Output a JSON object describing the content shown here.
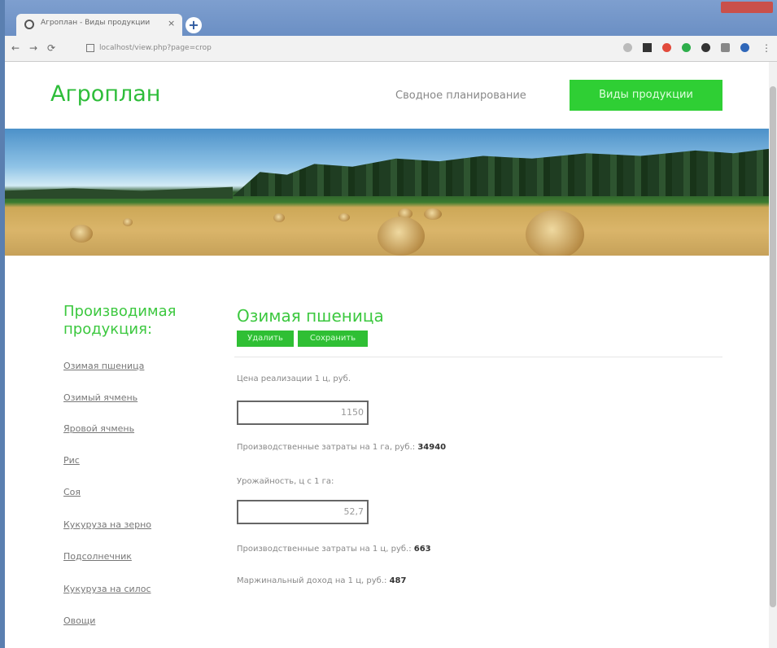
{
  "browser": {
    "tab_title": "Агроплан - Виды продукции",
    "tab_close": "×",
    "new_tab": "+",
    "url": "localhost/view.php?page=crop"
  },
  "header": {
    "logo": "Агроплан",
    "nav_link": "Сводное планирование",
    "nav_button": "Виды продукции",
    "accent_color": "#2fcf34"
  },
  "sidebar": {
    "title_line1": "Производимая",
    "title_line2": "продукция:",
    "items": [
      "Озимая пшеница",
      "Озимый ячмень",
      "Яровой ячмень",
      "Рис",
      "Соя",
      "Кукуруза на зерно",
      "Подсолнечник",
      "Кукуруза на силос",
      "Овощи"
    ]
  },
  "product": {
    "title": "Озимая пшеница",
    "delete_button": "Удалить",
    "save_button": "Сохранить",
    "price_label": "Цена реализации 1 ц, руб.",
    "price_value": "1150",
    "cost_per_ha_label": "Производственные затраты на 1 га, руб.:",
    "cost_per_ha_value": "34940",
    "yield_label": "Урожайность, ц с 1 га:",
    "yield_value": "52,7",
    "cost_per_c_label": "Производственные затраты на 1 ц, руб.:",
    "cost_per_c_value": "663",
    "margin_label": "Маржинальный доход на 1 ц, руб.:",
    "margin_value": "487"
  }
}
